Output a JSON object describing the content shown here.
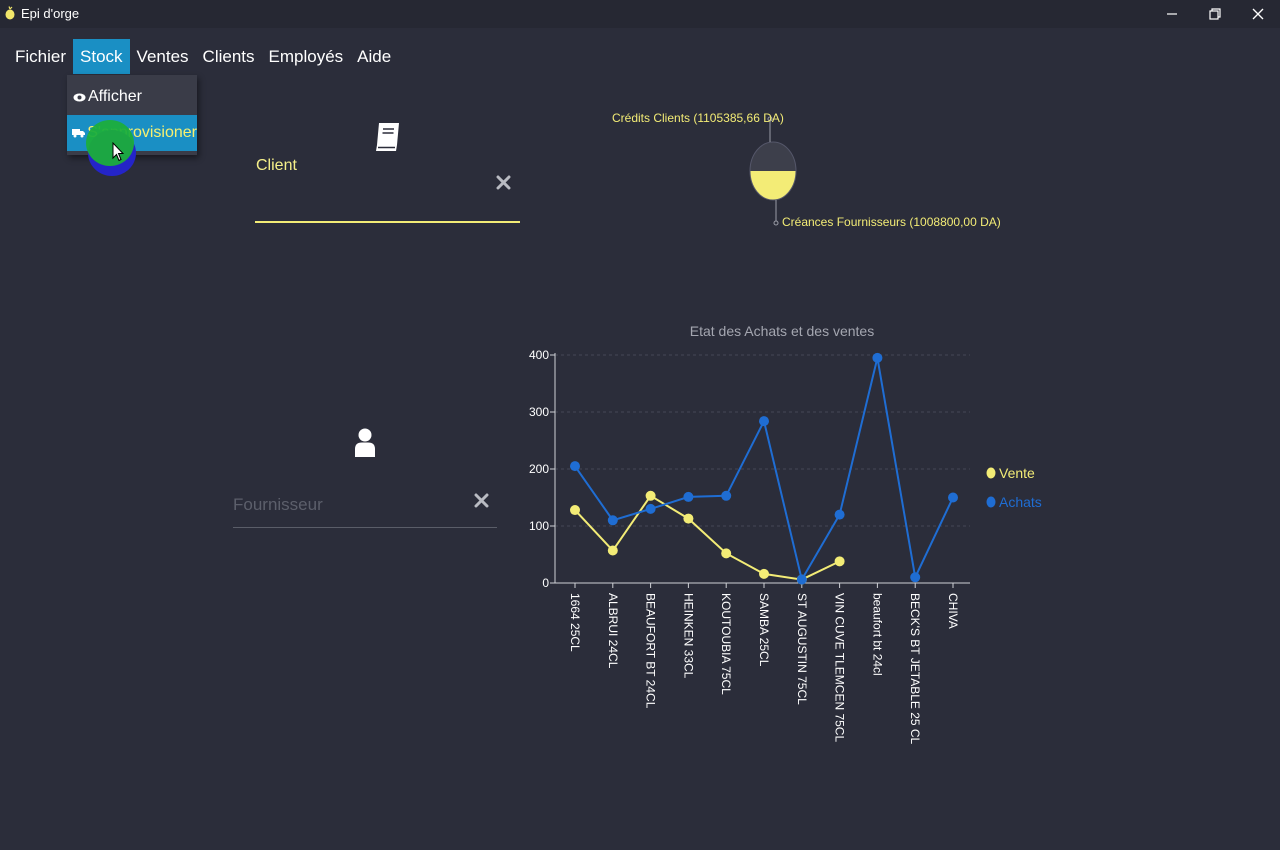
{
  "window": {
    "title": "Epi d'orge"
  },
  "menubar": {
    "items": [
      "Fichier",
      "Stock",
      "Ventes",
      "Clients",
      "Employés",
      "Aide"
    ],
    "active": "Stock"
  },
  "dropdown": {
    "items": [
      {
        "label": "Afficher",
        "icon": "eye-icon"
      },
      {
        "label": "S'approvisioner",
        "icon": "truck-icon"
      }
    ],
    "selected": "S'approvisioner"
  },
  "client_panel": {
    "label": "Client",
    "value": ""
  },
  "supplier_panel": {
    "placeholder": "Fournisseur",
    "value": ""
  },
  "pie": {
    "labels": {
      "clients": "Crédits Clients (1105385,66 DA)",
      "fournisseurs": "Créances Fournisseurs (1008800,00 DA)"
    },
    "colors": {
      "clients": "#3a3c48",
      "fournisseurs": "#f3ec76"
    }
  },
  "chart_data": {
    "type": "line",
    "title": "Etat des Achats et des ventes",
    "xlabel": "",
    "ylabel": "",
    "ylim": [
      0,
      400
    ],
    "yticks": [
      0,
      100,
      200,
      300,
      400
    ],
    "grid": true,
    "legend_position": "right",
    "categories": [
      "1664 25CL",
      "ALBRUI 24CL",
      "BEAUFORT BT 24CL",
      "HEINKEN 33CL",
      "KOUTOUBIA 75CL",
      "SAMBA 25CL",
      "ST AUGUSTIN 75CL",
      "VIN CUVE TLEMCEN 75CL",
      "beaufort bt 24cl",
      "BECK'S BT JETABLE 25 CL",
      "CHIVA"
    ],
    "series": [
      {
        "name": "Vente",
        "color": "#f3ec76",
        "values": [
          128,
          57,
          153,
          113,
          52,
          16,
          6,
          38,
          null,
          null,
          null
        ]
      },
      {
        "name": "Achats",
        "color": "#1f6dd3",
        "values": [
          205,
          110,
          130,
          151,
          153,
          284,
          6,
          120,
          395,
          10,
          150
        ]
      }
    ]
  }
}
